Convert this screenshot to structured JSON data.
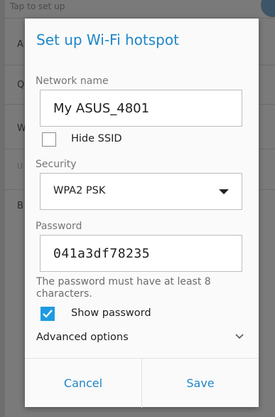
{
  "background": {
    "top_text": "Tap to set up",
    "row_letters": [
      "A",
      "Q",
      "W",
      "U",
      "B"
    ]
  },
  "dialog": {
    "title": "Set up Wi-Fi hotspot",
    "network_name_label": "Network name",
    "network_name_value": "My ASUS_4801",
    "hide_ssid_label": "Hide SSID",
    "hide_ssid_checked": false,
    "security_label": "Security",
    "security_value": "WPA2 PSK",
    "password_label": "Password",
    "password_value": "041a3df78235",
    "password_hint": "The password must have at least 8 characters.",
    "show_password_label": "Show password",
    "show_password_checked": true,
    "advanced_options_label": "Advanced options",
    "cancel_label": "Cancel",
    "save_label": "Save"
  },
  "colors": {
    "accent": "#1f86c8",
    "checkbox_checked": "#1f9ae0",
    "scrim": "#7a7a7a"
  },
  "icons": [
    "dropdown-arrow-icon",
    "checkbox-check-icon",
    "chevron-down-icon"
  ]
}
